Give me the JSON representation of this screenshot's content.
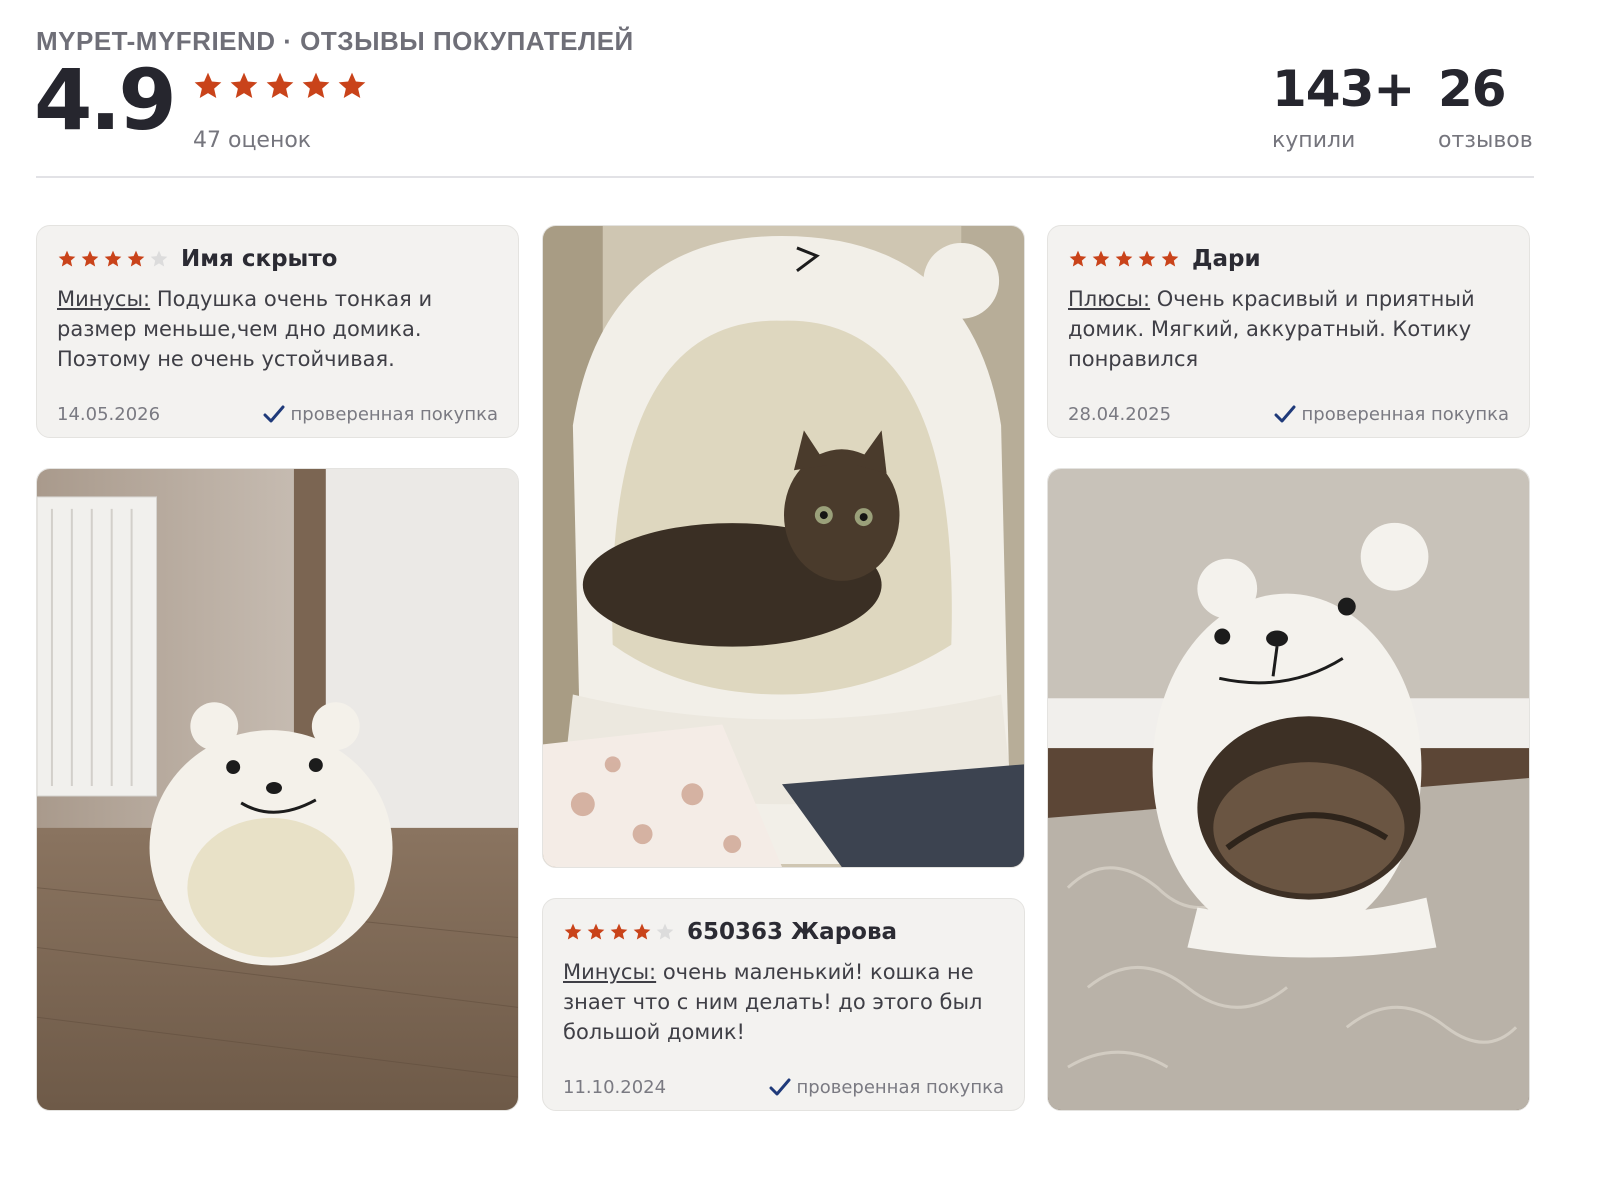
{
  "header": {
    "title": "MYPET-MYFRIEND · ОТЗЫВЫ ПОКУПАТЕЛЕЙ",
    "rating": "4.9",
    "stars": 5,
    "ratings_count": "47 оценок",
    "bought_value": "143+",
    "bought_label": "купили",
    "reviews_value": "26",
    "reviews_label": "отзывов"
  },
  "colors": {
    "star_filled": "#c9431a",
    "star_empty": "#dcdcdc",
    "check": "#1f3a7a"
  },
  "reviews": [
    {
      "stars": 4,
      "author": "Имя скрыто",
      "label": "Минусы:",
      "text": " Подушка очень тонкая и размер меньше,чем дно домика. Поэтому не очень устойчивая.",
      "date": "14.05.2026",
      "verified": "проверенная покупка"
    },
    {
      "stars": 5,
      "author": "Дари",
      "label": "Плюсы:",
      "text": " Очень красивый и приятный домик. Мягкий, аккуратный. Котику понравился",
      "date": "28.04.2025",
      "verified": "проверенная покупка"
    },
    {
      "stars": 4,
      "author": "650363 Жарова",
      "label": "Минусы:",
      "text": " очень маленький! кошка не знает что с ним делать! до этого был большой домик!",
      "date": "11.10.2024",
      "verified": "проверенная покупка"
    }
  ],
  "photos": {
    "photo_1_icon": "bear-cat-house-empty-photo",
    "photo_2_icon": "cat-inside-bear-house-photo",
    "photo_3_icon": "cat-sleeping-bear-house-photo"
  }
}
